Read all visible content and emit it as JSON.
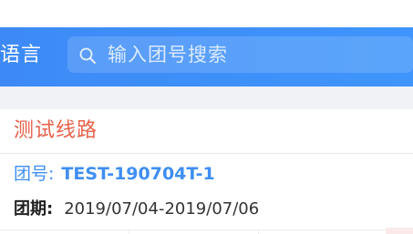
{
  "header": {
    "language_label": "语言",
    "search": {
      "placeholder": "输入团号搜索",
      "icon": "search-icon"
    },
    "background_color": "#3f8ef7"
  },
  "tour_card": {
    "route_title": "测试线路",
    "route_title_color": "#e8614a",
    "group_no": {
      "label": "团号:",
      "value": "TEST-190704T-1"
    },
    "group_period": {
      "label": "团期:",
      "value": "2019/07/04-2019/07/06"
    }
  }
}
